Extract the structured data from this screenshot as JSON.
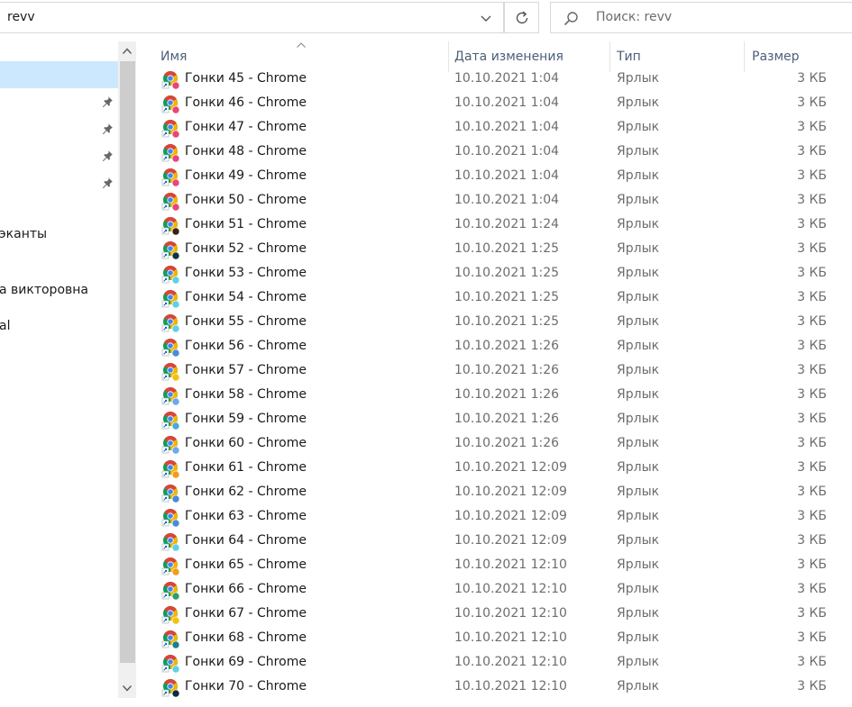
{
  "address": {
    "path": "revv"
  },
  "search": {
    "placeholder": "Поиск: revv"
  },
  "nav": {
    "items": [
      {
        "label": "",
        "selected": true,
        "pinned": false
      },
      {
        "label": "",
        "selected": false,
        "pinned": true
      },
      {
        "label": "",
        "selected": false,
        "pinned": true
      },
      {
        "label": "",
        "selected": false,
        "pinned": true
      },
      {
        "label": "",
        "selected": false,
        "pinned": true
      },
      {
        "label": "эканты",
        "selected": false,
        "pinned": false
      },
      {
        "label": "а викторовна",
        "selected": false,
        "pinned": false
      },
      {
        "label": "al",
        "selected": false,
        "pinned": false
      }
    ]
  },
  "columns": {
    "name": "Имя",
    "date": "Дата изменения",
    "type": "Тип",
    "size": "Размер"
  },
  "colors": {
    "selection": "#cce8ff",
    "header_text": "#4c607a",
    "chrome_red": "#db4437",
    "chrome_yellow": "#f4b400",
    "chrome_green": "#0f9d58",
    "chrome_blue": "#4285f4"
  },
  "files": [
    {
      "name": "Гонки 45 - Chrome",
      "date": "10.10.2021 1:04",
      "type": "Ярлык",
      "size": "3 КБ",
      "badge": "#e8457c"
    },
    {
      "name": "Гонки 46 - Chrome",
      "date": "10.10.2021 1:04",
      "type": "Ярлык",
      "size": "3 КБ",
      "badge": "#e8457c"
    },
    {
      "name": "Гонки 47 - Chrome",
      "date": "10.10.2021 1:04",
      "type": "Ярлык",
      "size": "3 КБ",
      "badge": "#e8457c"
    },
    {
      "name": "Гонки 48 - Chrome",
      "date": "10.10.2021 1:04",
      "type": "Ярлык",
      "size": "3 КБ",
      "badge": "#e8457c"
    },
    {
      "name": "Гонки 49 - Chrome",
      "date": "10.10.2021 1:04",
      "type": "Ярлык",
      "size": "3 КБ",
      "badge": "#e8457c"
    },
    {
      "name": "Гонки 50 - Chrome",
      "date": "10.10.2021 1:04",
      "type": "Ярлык",
      "size": "3 КБ",
      "badge": "#e8457c"
    },
    {
      "name": "Гонки 51 - Chrome",
      "date": "10.10.2021 1:24",
      "type": "Ярлык",
      "size": "3 КБ",
      "badge": "#3a1f12"
    },
    {
      "name": "Гонки 52 - Chrome",
      "date": "10.10.2021 1:25",
      "type": "Ярлык",
      "size": "3 КБ",
      "badge": "#0e3340"
    },
    {
      "name": "Гонки 53 - Chrome",
      "date": "10.10.2021 1:25",
      "type": "Ярлык",
      "size": "3 КБ",
      "badge": "#5fd0e6"
    },
    {
      "name": "Гонки 54 - Chrome",
      "date": "10.10.2021 1:25",
      "type": "Ярлык",
      "size": "3 КБ",
      "badge": "#5fd0e6"
    },
    {
      "name": "Гонки 55 - Chrome",
      "date": "10.10.2021 1:25",
      "type": "Ярлык",
      "size": "3 КБ",
      "badge": "#5fd0e6"
    },
    {
      "name": "Гонки 56 - Chrome",
      "date": "10.10.2021 1:26",
      "type": "Ярлык",
      "size": "3 КБ",
      "badge": "#4a8ad8"
    },
    {
      "name": "Гонки 57 - Chrome",
      "date": "10.10.2021 1:26",
      "type": "Ярлык",
      "size": "3 КБ",
      "badge": "#f4c20d"
    },
    {
      "name": "Гонки 58 - Chrome",
      "date": "10.10.2021 1:26",
      "type": "Ярлык",
      "size": "3 КБ",
      "badge": "#6aa9f0"
    },
    {
      "name": "Гонки 59 - Chrome",
      "date": "10.10.2021 1:26",
      "type": "Ярлык",
      "size": "3 КБ",
      "badge": "#4aa8d8"
    },
    {
      "name": "Гонки 60 - Chrome",
      "date": "10.10.2021 1:26",
      "type": "Ярлык",
      "size": "3 КБ",
      "badge": "#6aa9f0"
    },
    {
      "name": "Гонки 61 - Chrome",
      "date": "10.10.2021 12:09",
      "type": "Ярлык",
      "size": "3 КБ",
      "badge": "#f29b1d"
    },
    {
      "name": "Гонки 62 - Chrome",
      "date": "10.10.2021 12:09",
      "type": "Ярлык",
      "size": "3 КБ",
      "badge": "#4a8ad8"
    },
    {
      "name": "Гонки 63 - Chrome",
      "date": "10.10.2021 12:09",
      "type": "Ярлык",
      "size": "3 КБ",
      "badge": "#4a8ad8"
    },
    {
      "name": "Гонки 64 - Chrome",
      "date": "10.10.2021 12:09",
      "type": "Ярлык",
      "size": "3 КБ",
      "badge": "#5fd0e6"
    },
    {
      "name": "Гонки 65 - Chrome",
      "date": "10.10.2021 12:10",
      "type": "Ярлык",
      "size": "3 КБ",
      "badge": "#f29b1d"
    },
    {
      "name": "Гонки 66 - Chrome",
      "date": "10.10.2021 12:10",
      "type": "Ярлык",
      "size": "3 КБ",
      "badge": "#2e9e6a"
    },
    {
      "name": "Гонки 67 - Chrome",
      "date": "10.10.2021 12:10",
      "type": "Ярлык",
      "size": "3 КБ",
      "badge": "#f4c20d"
    },
    {
      "name": "Гонки 68 - Chrome",
      "date": "10.10.2021 12:10",
      "type": "Ярлык",
      "size": "3 КБ",
      "badge": "#1b7f8c"
    },
    {
      "name": "Гонки 69 - Chrome",
      "date": "10.10.2021 12:10",
      "type": "Ярлык",
      "size": "3 КБ",
      "badge": "#5fd0e6"
    },
    {
      "name": "Гонки 70 - Chrome",
      "date": "10.10.2021 12:10",
      "type": "Ярлык",
      "size": "3 КБ",
      "badge": "#0e2a40"
    }
  ]
}
